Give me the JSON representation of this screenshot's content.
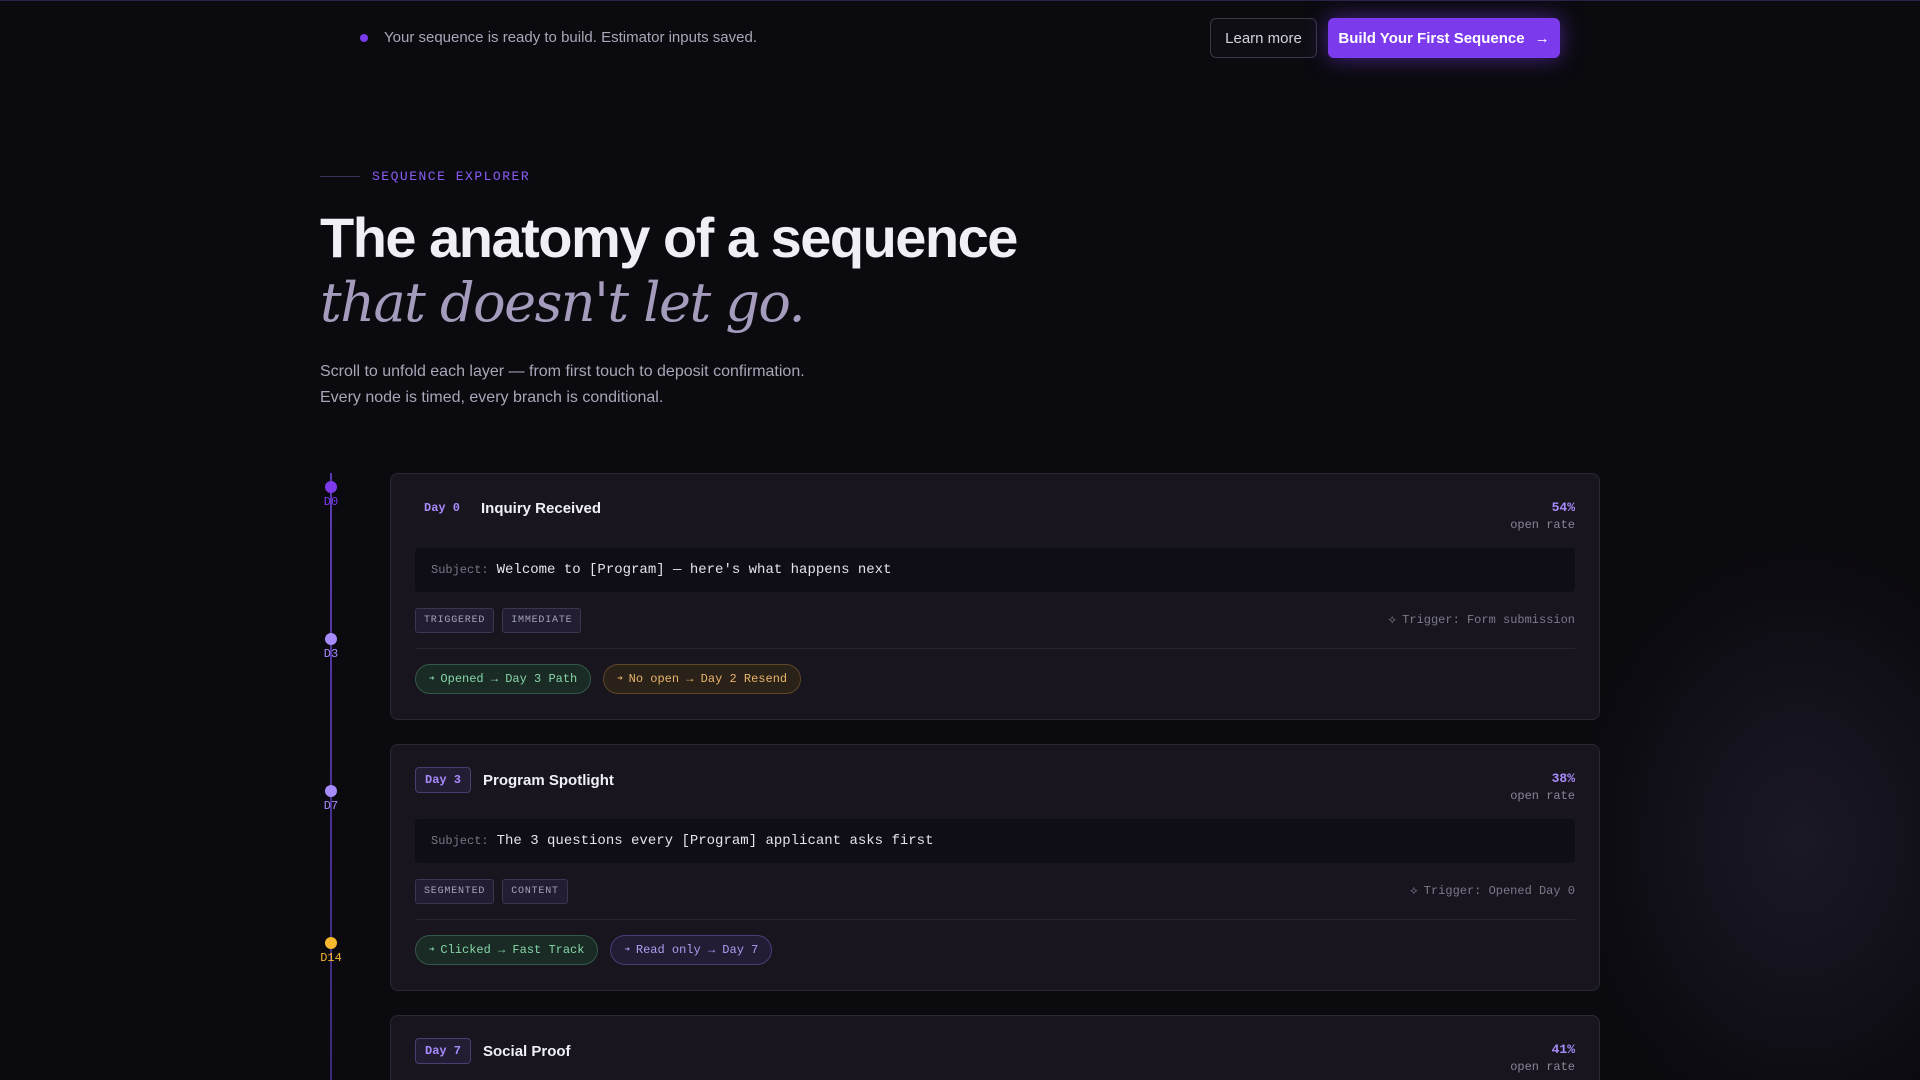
{
  "banner": {
    "message": "Your sequence is ready to build. Estimator inputs saved.",
    "learn_more": "Learn more",
    "build_cta": "Build Your First Sequence",
    "build_cta_icon": "→"
  },
  "hero": {
    "eyebrow": "SEQUENCE EXPLORER",
    "title": "The anatomy of a sequence",
    "subtitle": "that doesn't let go.",
    "desc_line1": "Scroll to unfold each layer — from first touch to deposit confirmation.",
    "desc_line2": "Every node is timed, every branch is conditional."
  },
  "timeline": {
    "nodes": [
      {
        "label": "D0",
        "color": "#7c3aed"
      },
      {
        "label": "D3",
        "color": "#a78bfa"
      },
      {
        "label": "D7",
        "color": "#a78bfa"
      },
      {
        "label": "D14",
        "color": "#f5b82e"
      }
    ]
  },
  "cards": [
    {
      "day": "Day 0",
      "title": "Inquiry Received",
      "rate": "54%",
      "rate_label": "open rate",
      "subject_label": "Subject:",
      "subject": "Welcome to [Program] — here's what happens next",
      "tags": [
        "TRIGGERED",
        "IMMEDIATE"
      ],
      "trigger": "Trigger: Form submission",
      "paths": [
        {
          "label": "Opened → Day 3 Path",
          "tone": "green"
        },
        {
          "label": "No open → Day 2 Resend",
          "tone": "amber"
        }
      ]
    },
    {
      "day": "Day 3",
      "title": "Program Spotlight",
      "rate": "38%",
      "rate_label": "open rate",
      "subject_label": "Subject:",
      "subject": "The 3 questions every [Program] applicant asks first",
      "tags": [
        "SEGMENTED",
        "CONTENT"
      ],
      "trigger": "Trigger: Opened Day 0",
      "paths": [
        {
          "label": "Clicked → Fast Track",
          "tone": "green"
        },
        {
          "label": "Read only → Day 7",
          "tone": "purple"
        }
      ]
    },
    {
      "day": "Day 7",
      "title": "Social Proof",
      "rate": "41%",
      "rate_label": "open rate"
    }
  ],
  "icons": {
    "trigger": "⟡",
    "path_arrow": "➜"
  },
  "colors": {
    "accent": "#7c3aed",
    "accent_light": "#a78bfa",
    "background": "#0b0a0f",
    "card": "#18151f"
  }
}
